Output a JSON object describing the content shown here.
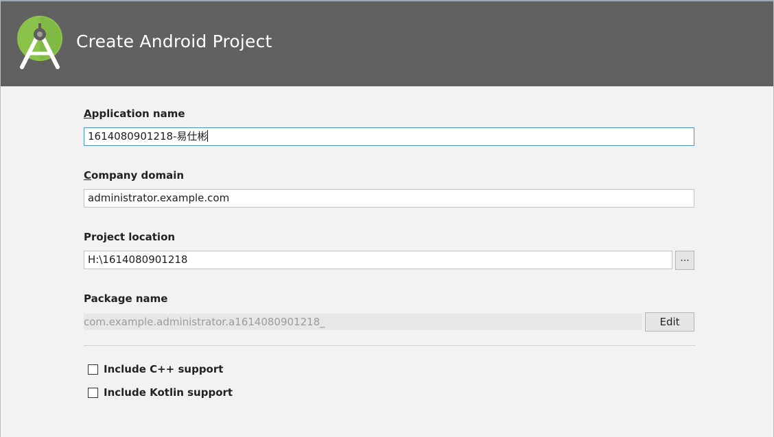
{
  "window": {
    "title": "Create Android Project"
  },
  "colors": {
    "header_bg": "#616161",
    "content_bg": "#f2f2f2",
    "focus_border": "#4a95c8",
    "logo_green": "#8bc34a"
  },
  "icons": {
    "logo": "android-studio-logo-icon"
  },
  "form": {
    "app_name": {
      "label_mnemonic": "A",
      "label_rest": "pplication name",
      "value": "1614080901218-易仕彬"
    },
    "company_domain": {
      "label_mnemonic": "C",
      "label_rest": "ompany domain",
      "value": "administrator.example.com"
    },
    "project_location": {
      "label": "Project location",
      "value": "H:\\1614080901218",
      "browse_label": "..."
    },
    "package_name": {
      "label": "Package name",
      "value": "com.example.administrator.a1614080901218_",
      "edit_label": "Edit"
    }
  },
  "options": {
    "cpp_support": {
      "label": "Include C++ support",
      "checked": false
    },
    "kotlin_support": {
      "label": "Include Kotlin support",
      "checked": false
    }
  }
}
